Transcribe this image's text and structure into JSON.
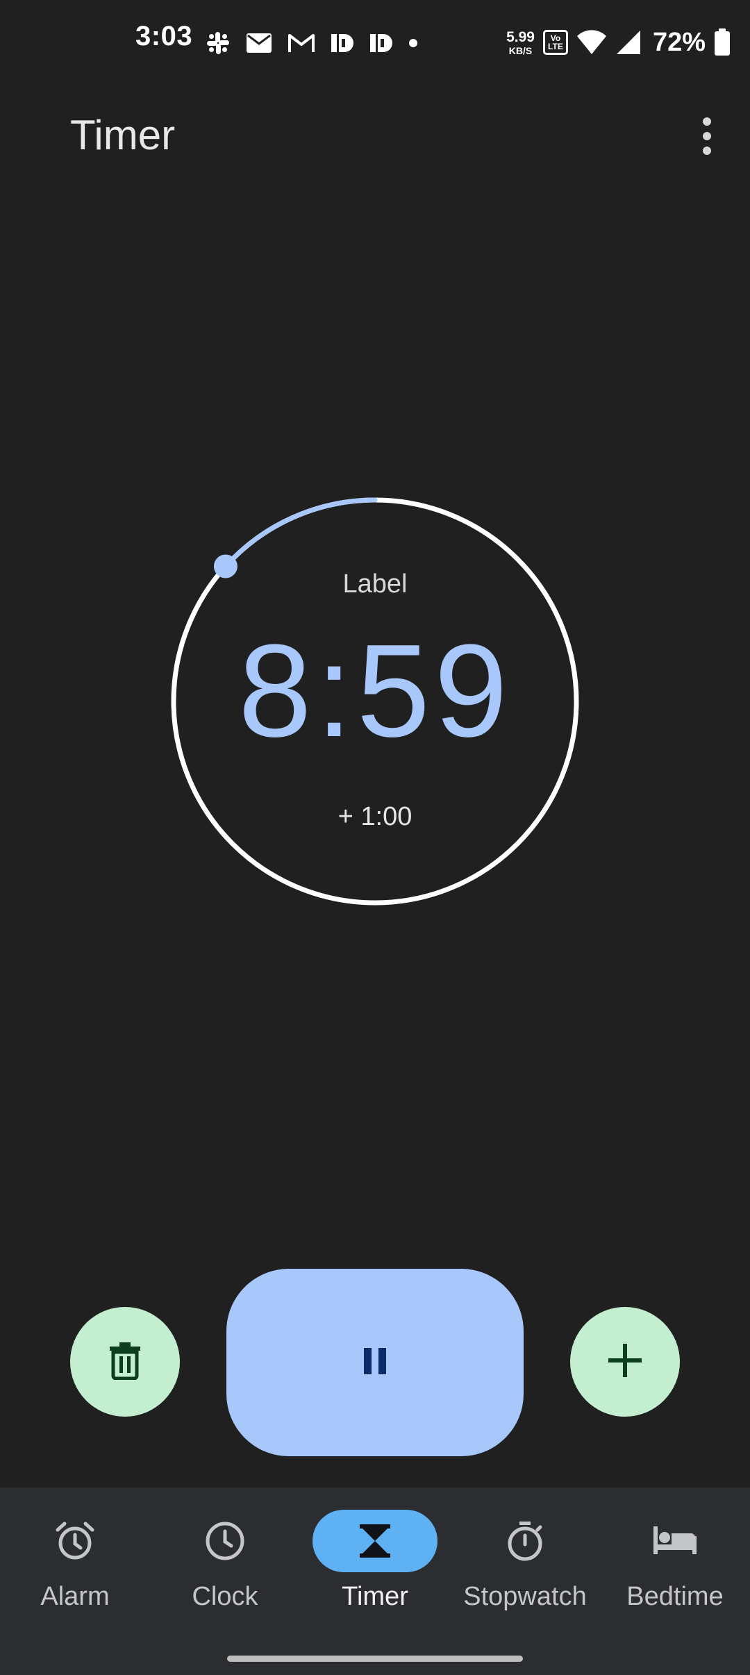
{
  "status_bar": {
    "time": "3:03",
    "net_speed_value": "5.99",
    "net_speed_unit": "KB/S",
    "volte_top": "Vo",
    "volte_bottom": "LTE",
    "battery_percent": "72%",
    "battery_level": 0.72,
    "notification_icons": [
      "slack-icon",
      "email-icon",
      "gmail-icon",
      "app-icon",
      "app-icon",
      "dot-icon"
    ]
  },
  "app_bar": {
    "title": "Timer",
    "menu_icon": "more-vert-icon"
  },
  "timer": {
    "label": "Label",
    "time_display": "8:59",
    "add_time_button": "+ 1:00",
    "progress_elapsed_fraction": 0.133,
    "colors": {
      "accent": "#a8c7fa",
      "ring": "#ffffff"
    }
  },
  "actions": {
    "delete_icon": "delete-icon",
    "pause_icon": "pause-icon",
    "add_icon": "add-icon",
    "fab_color": "#c4eed0",
    "primary_color": "#a8c7fa"
  },
  "bottom_nav": {
    "active": "Timer",
    "items": [
      {
        "label": "Alarm",
        "icon": "alarm-icon"
      },
      {
        "label": "Clock",
        "icon": "clock-icon"
      },
      {
        "label": "Timer",
        "icon": "hourglass-icon"
      },
      {
        "label": "Stopwatch",
        "icon": "stopwatch-icon"
      },
      {
        "label": "Bedtime",
        "icon": "bed-icon"
      }
    ],
    "active_pill_color": "#5eb1f2"
  }
}
